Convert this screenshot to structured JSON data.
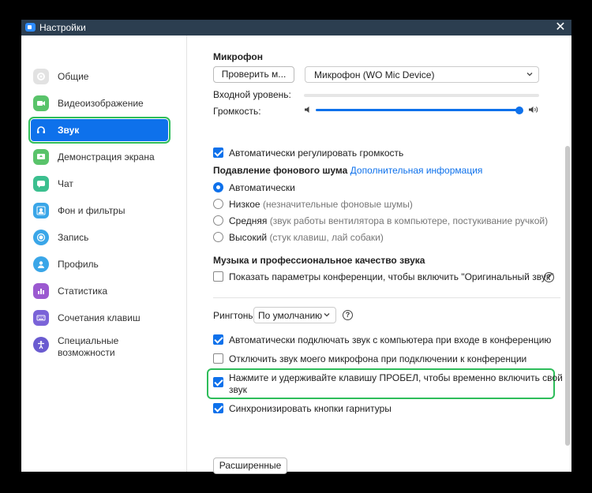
{
  "window": {
    "title": "Настройки",
    "close_glyph": "✕"
  },
  "sidebar": {
    "items": [
      {
        "label": "Общие",
        "icon": "gear-icon",
        "color": "#dcdcdc"
      },
      {
        "label": "Видеоизображение",
        "icon": "camera-icon",
        "color": "#59c36a"
      },
      {
        "label": "Звук",
        "icon": "headphones-icon",
        "color": "#0e71eb",
        "active": true
      },
      {
        "label": "Демонстрация экрана",
        "icon": "screen-share-icon",
        "color": "#59c36a"
      },
      {
        "label": "Чат",
        "icon": "chat-icon",
        "color": "#3bbf8f"
      },
      {
        "label": "Фон и фильтры",
        "icon": "person-background-icon",
        "color": "#3aa6e8"
      },
      {
        "label": "Запись",
        "icon": "record-icon",
        "color": "#3aa6e8"
      },
      {
        "label": "Профиль",
        "icon": "profile-icon",
        "color": "#3aa6e8"
      },
      {
        "label": "Статистика",
        "icon": "statistics-icon",
        "color": "#9b59d0"
      },
      {
        "label": "Сочетания клавиш",
        "icon": "keyboard-icon",
        "color": "#7a63d8"
      },
      {
        "label": "Специальные возможности",
        "icon": "accessibility-icon",
        "color": "#6a5bd0"
      }
    ]
  },
  "mic": {
    "title": "Микрофон",
    "test_button": "Проверить м...",
    "device": "Микрофон (WO Mic Device)",
    "input_level_label": "Входной уровень:",
    "volume_label": "Громкость:",
    "volume_value": 1.0,
    "auto_adjust": {
      "label": "Автоматически регулировать громкость",
      "checked": true
    }
  },
  "noise": {
    "title": "Подавление фонового шума",
    "more_info": "Дополнительная информация",
    "options": [
      {
        "label": "Автоматически",
        "hint": "",
        "selected": true
      },
      {
        "label": "Низкое",
        "hint": "(незначительные фоновые шумы)",
        "selected": false
      },
      {
        "label": "Средняя",
        "hint": "(звук работы вентилятора в компьютере, постукивание ручкой)",
        "selected": false
      },
      {
        "label": "Высокий",
        "hint": "(стук клавиш, лай собаки)",
        "selected": false
      }
    ]
  },
  "music": {
    "title": "Музыка и профессиональное качество звука",
    "original_sound": {
      "label": "Показать параметры конференции, чтобы включить \"Оригинальный звук\"",
      "checked": false
    },
    "help": "?"
  },
  "ringtones": {
    "label": "Рингтоны",
    "value": "По умолчанию",
    "help": "?"
  },
  "options": [
    {
      "label": "Автоматически подключать звук с компьютера при входе в конференцию",
      "checked": true
    },
    {
      "label": "Отключить звук моего микрофона при подключении к конференции",
      "checked": false
    },
    {
      "label_line1": "Нажмите и удерживайте клавишу ПРОБЕЛ, чтобы временно включить свой",
      "label_line2": "звук",
      "checked": true
    },
    {
      "label": "Синхронизировать кнопки гарнитуры",
      "checked": true
    }
  ],
  "advanced_button": "Расширенные",
  "colors": {
    "accent": "#0e71eb",
    "highlight": "#2ebd5a",
    "titlebar": "#2c3e50"
  }
}
